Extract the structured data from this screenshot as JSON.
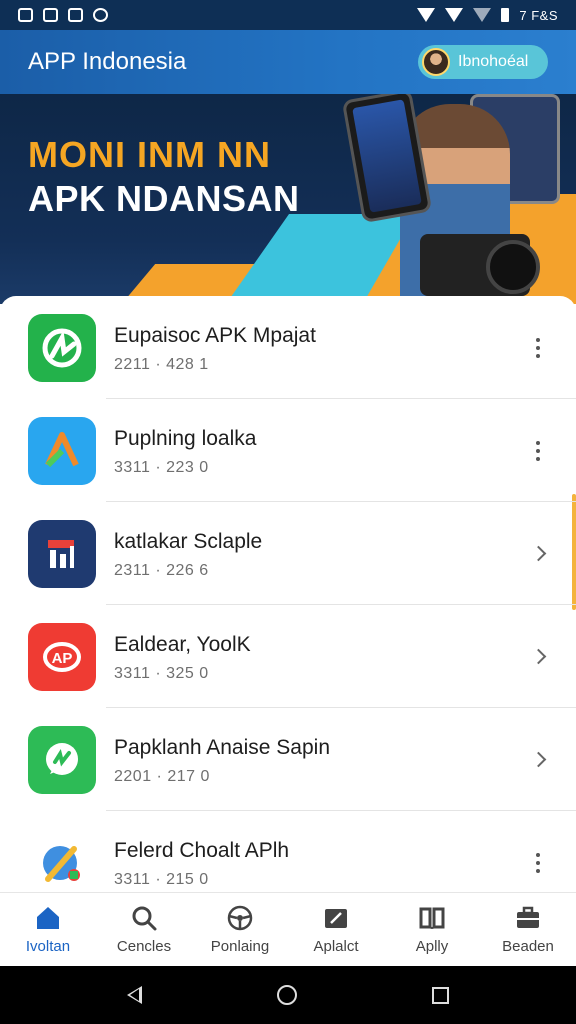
{
  "status_bar": {
    "right_text": "7 F&S"
  },
  "app_bar": {
    "title": "APP Indonesia",
    "profile_label": "Ibnohoéal"
  },
  "banner": {
    "headline_1": "MONI INM NN",
    "headline_2": "APK NDANSAN"
  },
  "apps": [
    {
      "name": "Eupaisoc APK Mpajat",
      "meta": "2211 · 428 1",
      "icon_color": "#23b24b",
      "icon": "pinwheel-icon",
      "action": "more-vertical-icon"
    },
    {
      "name": "Puplning loalka",
      "meta": "3311 · 223 0",
      "icon_color": "#29a6ef",
      "icon": "arrow-a-icon",
      "action": "more-vertical-icon"
    },
    {
      "name": "katlakar Sclaple",
      "meta": "2311 · 226 6",
      "icon_color": "#1f3a70",
      "icon": "flag-chart-icon",
      "action": "chevron-right-icon"
    },
    {
      "name": "Ealdear, YoolK",
      "meta": "3311 · 325 0",
      "icon_color": "#ef3b33",
      "icon": "ap-badge-icon",
      "action": "chevron-right-icon"
    },
    {
      "name": "Papklanh Anaise Sapin",
      "meta": "2201 · 217 0",
      "icon_color": "#2dbb56",
      "icon": "chat-bubble-icon",
      "action": "chevron-right-icon"
    },
    {
      "name": "Felerd Choalt APlh",
      "meta": "3311 · 215 0",
      "icon_color": "#3f8fe0",
      "icon": "pen-map-icon",
      "action": "more-vertical-icon"
    }
  ],
  "bottom_nav": [
    {
      "label": "Ivoltan",
      "icon": "home-icon",
      "active": true
    },
    {
      "label": "Cencles",
      "icon": "search-icon",
      "active": false
    },
    {
      "label": "Ponlaing",
      "icon": "steering-icon",
      "active": false
    },
    {
      "label": "Aplalct",
      "icon": "folder-edit-icon",
      "active": false
    },
    {
      "label": "Aplly",
      "icon": "book-icon",
      "active": false
    },
    {
      "label": "Beaden",
      "icon": "briefcase-icon",
      "active": false
    }
  ],
  "colors": {
    "primary": "#1b64c4",
    "accent_orange": "#f5a623",
    "accent_cyan": "#3cc3dd"
  }
}
